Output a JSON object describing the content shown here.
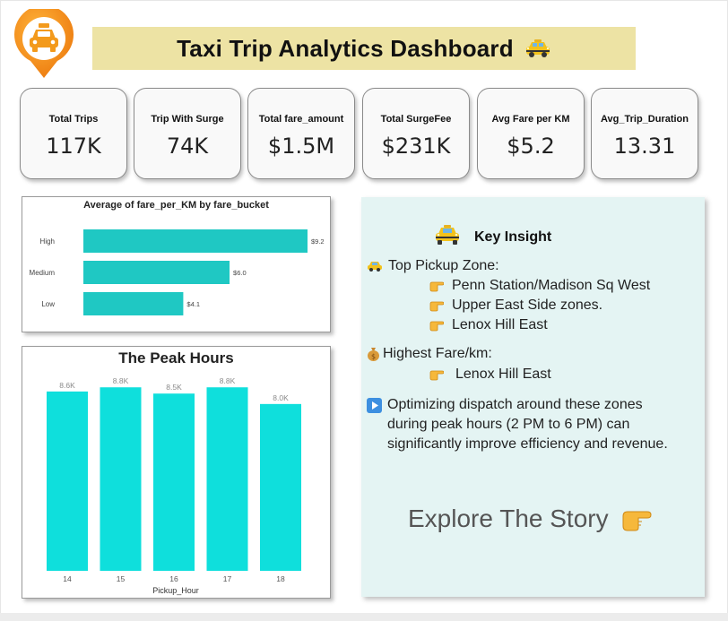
{
  "header": {
    "title": "Taxi Trip Analytics Dashboard"
  },
  "kpis": [
    {
      "label": "Total Trips",
      "value": "117K"
    },
    {
      "label": "Trip With Surge",
      "value": "74K"
    },
    {
      "label": "Total fare_amount",
      "value": "$1.5M"
    },
    {
      "label": "Total SurgeFee",
      "value": "$231K"
    },
    {
      "label": "Avg Fare per KM",
      "value": "$5.2"
    },
    {
      "label": "Avg_Trip_Duration",
      "value": "13.31"
    }
  ],
  "chart_data": [
    {
      "type": "bar",
      "orientation": "horizontal",
      "title": "Average of fare_per_KM by fare_bucket",
      "categories": [
        "High",
        "Medium",
        "Low"
      ],
      "values": [
        9.2,
        6.0,
        4.1
      ],
      "data_labels": [
        "$9.2",
        "$6.0",
        "$4.1"
      ],
      "color": "#1fc8c3",
      "grid": false
    },
    {
      "type": "bar",
      "title": "The Peak Hours",
      "xlabel": "Pickup_Hour",
      "ylabel": "",
      "categories": [
        "14",
        "15",
        "16",
        "17",
        "18"
      ],
      "values": [
        8.6,
        8.8,
        8.5,
        8.8,
        8.0
      ],
      "data_labels": [
        "8.6K",
        "8.8K",
        "8.5K",
        "8.8K",
        "8.0K"
      ],
      "color": "#0fdfdc",
      "grid": false
    }
  ],
  "insight": {
    "heading": "Key Insight",
    "pickup_label": "Top Pickup Zone:",
    "pickup_zones": [
      "Penn Station/Madison Sq West",
      "Upper East Side zones.",
      "Lenox Hill East"
    ],
    "fare_label": "Highest Fare/km:",
    "fare_zone": "Lenox Hill East",
    "recommendation": [
      "Optimizing dispatch around these zones",
      "during peak hours (2 PM to 6 PM) can",
      "significantly improve efficiency and revenue."
    ],
    "cta": "Explore The Story"
  },
  "colors": {
    "title_bg": "#ede3a4",
    "panel_bg": "#e4f4f3",
    "bar_fare": "#1fc8c3",
    "bar_peak": "#0fdfdc",
    "logo_orange": "#f39a1c"
  },
  "icons": [
    "taxi-pin-logo",
    "taxi-icon",
    "money-bag-icon",
    "pointing-hand-icon",
    "play-icon"
  ]
}
